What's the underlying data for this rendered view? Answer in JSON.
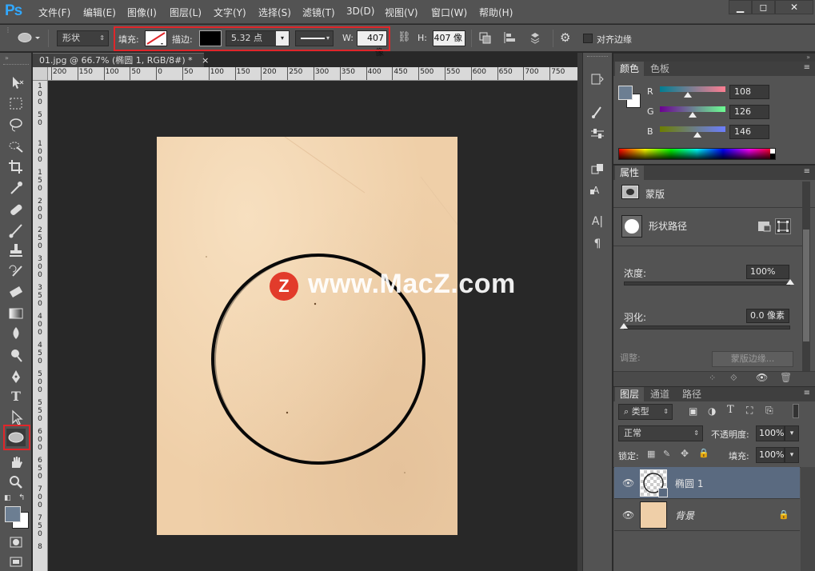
{
  "app": {
    "logo": "Ps"
  },
  "menu": [
    "文件(F)",
    "编辑(E)",
    "图像(I)",
    "图层(L)",
    "文字(Y)",
    "选择(S)",
    "滤镜(T)",
    "3D(D)",
    "视图(V)",
    "窗口(W)",
    "帮助(H)"
  ],
  "window_controls": {
    "minimize": "▁",
    "restore": "◻",
    "close": "✕"
  },
  "options": {
    "mode": "形状",
    "fill_label": "填充:",
    "stroke_label": "描边:",
    "stroke_size": "5.32 点",
    "w_label": "W:",
    "w_value": "407 像",
    "h_label": "H:",
    "h_value": "407 像",
    "align_edges": "对齐边缘"
  },
  "document": {
    "tab_title": "01.jpg @ 66.7% (椭圆 1, RGB/8#) *",
    "tab_close": "×",
    "ruler_h": [
      "200",
      "150",
      "100",
      "50",
      "0",
      "50",
      "100",
      "150",
      "200",
      "250",
      "300",
      "350",
      "400",
      "450",
      "500",
      "550",
      "600",
      "650",
      "700",
      "750"
    ],
    "ruler_v": [
      "1\n0\n0",
      "5\n0",
      "1\n0\n0",
      "1\n5\n0",
      "2\n0\n0",
      "2\n5\n0",
      "3\n0\n0",
      "3\n5\n0",
      "4\n0\n0",
      "4\n5\n0",
      "5\n0\n0",
      "5\n5\n0",
      "6\n0\n0",
      "6\n5\n0",
      "7\n0\n0",
      "7\n5\n0",
      "8"
    ],
    "watermark_badge": "Z",
    "watermark_text": "www.MacZ.com"
  },
  "color_panel": {
    "tabs": [
      "颜色",
      "色板"
    ],
    "r_label": "R",
    "g_label": "G",
    "b_label": "B",
    "r": 108,
    "g": 126,
    "b": 146,
    "fg_color": "#6c7e92",
    "bg_color": "#ffffff"
  },
  "properties_panel": {
    "tab": "属性",
    "mask_label": "蒙版",
    "shape_path_label": "形状路径",
    "density_label": "浓度:",
    "density_value": "100%",
    "density_fraction": 1.0,
    "feather_label": "羽化:",
    "feather_value": "0.0 像素",
    "feather_fraction": 0.0,
    "adjust_label": "调整:",
    "mask_edge_button": "蒙版边缘..."
  },
  "layers_panel": {
    "tabs": [
      "图层",
      "通道",
      "路径"
    ],
    "filter_kind": "类型",
    "blend_mode": "正常",
    "opacity_label": "不透明度:",
    "opacity_value": "100%",
    "lock_label": "锁定:",
    "fill_label": "填充:",
    "fill_value": "100%",
    "layers": [
      {
        "name": "椭圆 1",
        "selected": true
      },
      {
        "name": "背景",
        "selected": false
      }
    ]
  }
}
